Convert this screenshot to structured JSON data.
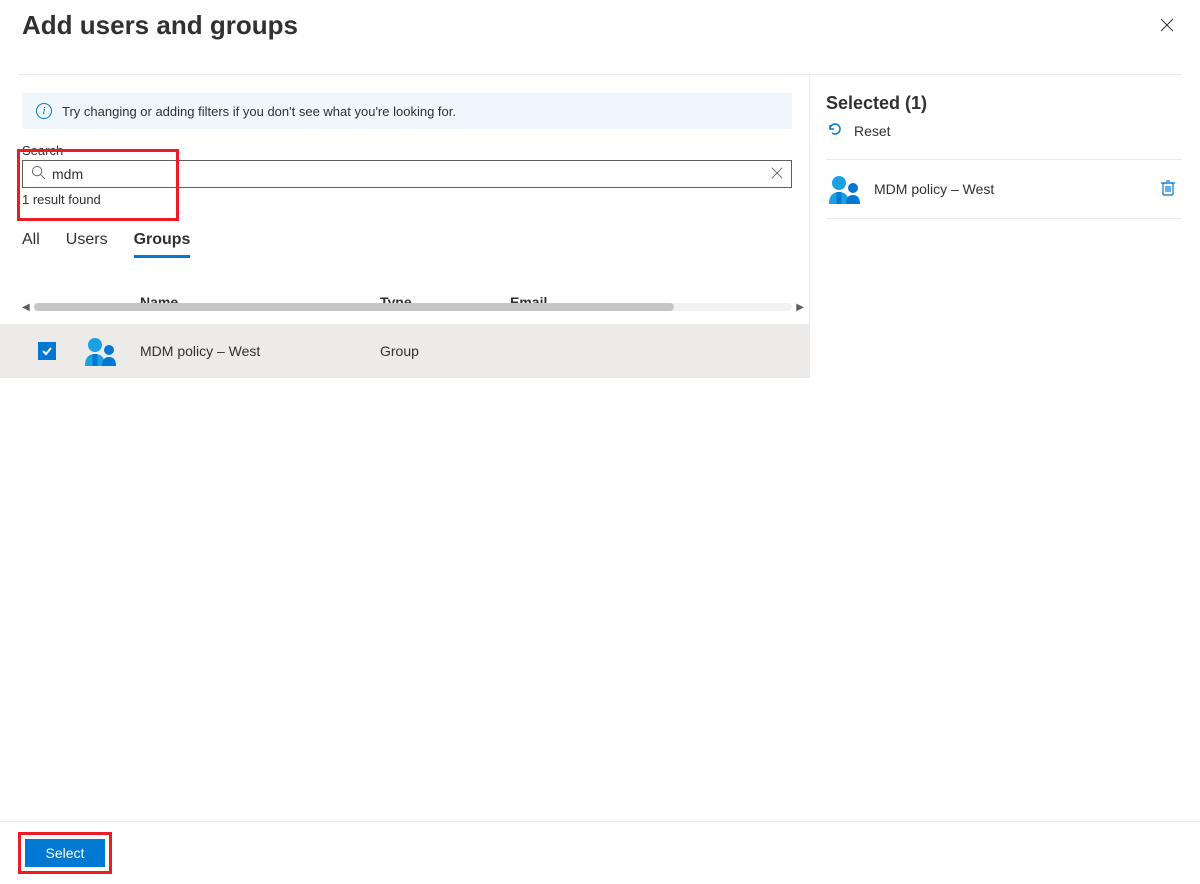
{
  "header": {
    "title": "Add users and groups"
  },
  "infoBanner": {
    "text": "Try changing or adding filters if you don't see what you're looking for."
  },
  "search": {
    "label": "Search",
    "value": "mdm",
    "resultCount": "1 result found"
  },
  "tabs": {
    "all": "All",
    "users": "Users",
    "groups": "Groups",
    "active": "groups"
  },
  "table": {
    "columns": {
      "name": "Name",
      "type": "Type",
      "email": "Email"
    },
    "rows": [
      {
        "checked": true,
        "name": "MDM policy – West",
        "type": "Group",
        "email": ""
      }
    ]
  },
  "selectedPanel": {
    "title": "Selected (1)",
    "reset": "Reset",
    "items": [
      {
        "name": "MDM policy – West"
      }
    ]
  },
  "footer": {
    "selectLabel": "Select"
  }
}
